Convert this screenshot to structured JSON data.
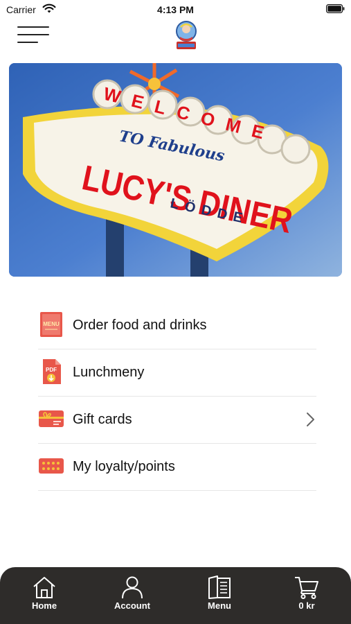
{
  "status_bar": {
    "carrier": "Carrier",
    "time": "4:13 PM"
  },
  "header": {
    "menu_icon": "hamburger-icon",
    "logo": "lucys-diner-logo"
  },
  "hero": {
    "sign_top": "WELCOME",
    "sign_script": "TO Fabulous",
    "sign_main": "LUCY'S DINER",
    "sign_sub": "LÖDDE"
  },
  "menu_list": {
    "items": [
      {
        "label": "Order food and drinks",
        "icon": "menu-book-icon"
      },
      {
        "label": "Lunchmeny",
        "icon": "pdf-download-icon"
      },
      {
        "label": "Gift cards",
        "icon": "gift-card-icon"
      },
      {
        "label": "My loyalty/points",
        "icon": "loyalty-card-icon"
      }
    ]
  },
  "tabbar": {
    "tabs": [
      {
        "label": "Home",
        "icon": "home-icon"
      },
      {
        "label": "Account",
        "icon": "account-icon"
      },
      {
        "label": "Menu",
        "icon": "menu-book-icon"
      },
      {
        "label": "0 kr",
        "icon": "cart-icon"
      }
    ]
  },
  "colors": {
    "accent": "#e8574a",
    "tabbar_bg": "#2e2c2a",
    "sign_red": "#e0121c",
    "sign_yellow": "#f2d43a"
  }
}
